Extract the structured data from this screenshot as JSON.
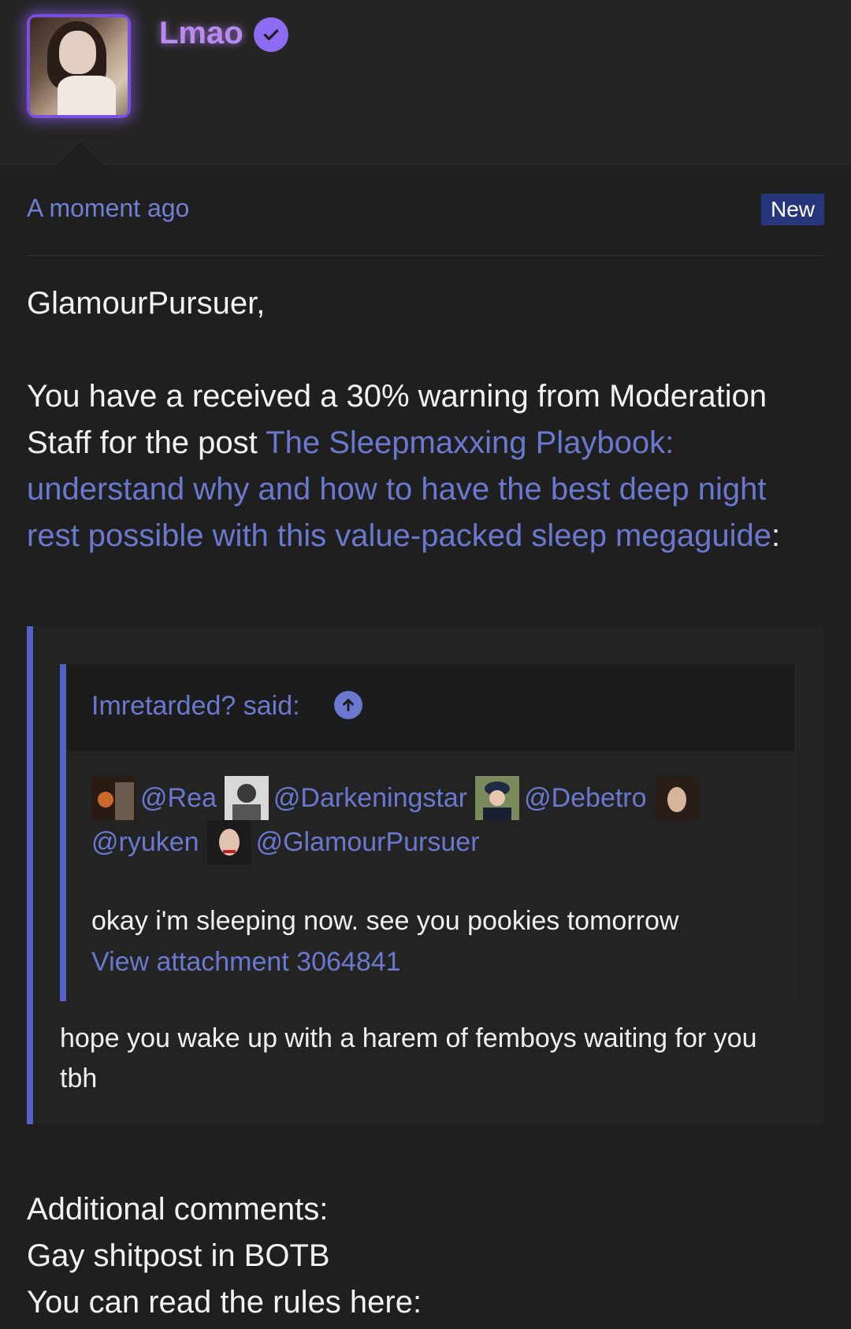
{
  "author": {
    "name": "Lmao",
    "verified_icon": "verified-check-icon",
    "accent": "#b98af0"
  },
  "post": {
    "time": "A moment ago",
    "badge": "New",
    "greeting": "GlamourPursuer,",
    "warning_prefix": "You have a received a 30% warning from Moderation Staff for the post ",
    "post_link": "The Sleepmaxxing Playbook: understand why and how to have the best deep night rest possible with this value-packed sleep megaguide",
    "warning_suffix": ":"
  },
  "quote": {
    "said": "Imretarded? said:",
    "arrow_icon": "arrow-up-circle-icon",
    "mentions": [
      "@Rea",
      "@Darkeningstar",
      "@Debetro",
      "@ryuken",
      "@GlamourPursuer"
    ],
    "text": "okay i'm sleeping now. see you pookies tomorrow",
    "attachment": "View attachment 3064841",
    "reply": "hope you wake up with a harem of femboys waiting for you tbh"
  },
  "additional": {
    "label": "Additional comments:",
    "line1": "Gay shitpost in BOTB",
    "line2": "You can read the rules here:"
  },
  "colors": {
    "background": "#1f1f1f",
    "link": "#6a79cf",
    "quote_bar": "#5462c6",
    "badge_bg": "#27357a"
  }
}
